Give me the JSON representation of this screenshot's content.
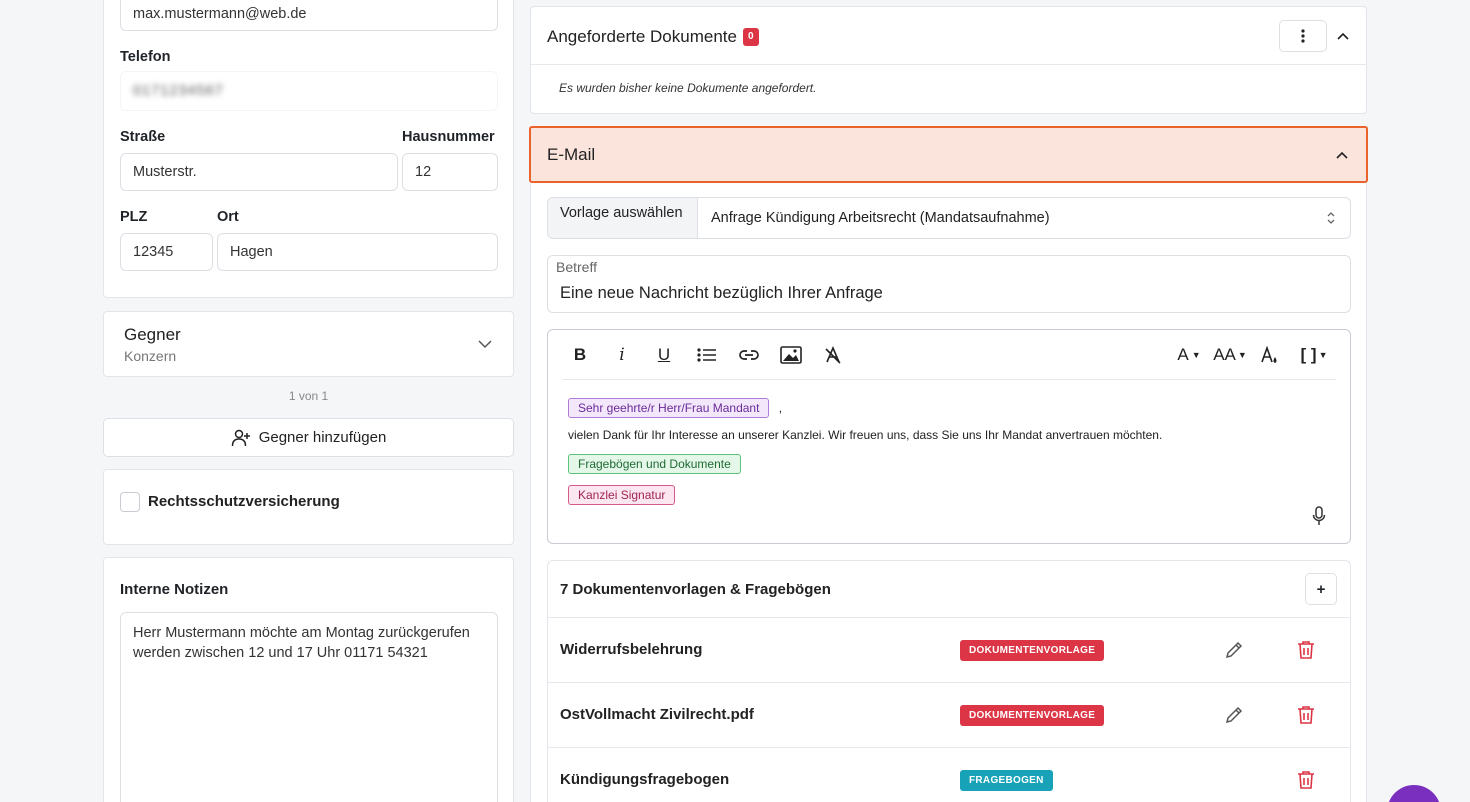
{
  "contact": {
    "email_value": "max.mustermann@web.de",
    "telefon_label": "Telefon",
    "telefon_value": "0171234567",
    "strasse_label": "Straße",
    "strasse_value": "Musterstr.",
    "hausnummer_label": "Hausnummer",
    "hausnummer_value": "12",
    "plz_label": "PLZ",
    "plz_value": "12345",
    "ort_label": "Ort",
    "ort_value": "Hagen"
  },
  "gegner": {
    "title": "Gegner",
    "subtitle": "Konzern",
    "pager": "1 von 1",
    "add_label": "Gegner hinzufügen"
  },
  "rechtsschutz": {
    "label": "Rechtsschutzversicherung",
    "checked": false
  },
  "notes": {
    "title": "Interne Notizen",
    "value": "Herr Mustermann möchte am Montag zurückgerufen werden zwischen 12 und 17 Uhr 01171 54321"
  },
  "docs": {
    "title": "Angeforderte Dokumente",
    "count": "0",
    "empty_text": "Es wurden bisher keine Dokumente angefordert."
  },
  "email": {
    "title": "E-Mail",
    "template_label": "Vorlage auswählen",
    "template_value": "Anfrage Kündigung Arbeitsrecht (Mandatsaufnahme)",
    "subject_label": "Betreff",
    "subject_value": "Eine neue Nachricht bezüglich Ihrer Anfrage",
    "chip_salutation": "Sehr geehrte/r Herr/Frau Mandant",
    "salutation_suffix": ",",
    "body_text": "vielen Dank für Ihr Interesse an unserer Kanzlei. Wir freuen uns, dass Sie uns Ihr Mandat anvertrauen möchten.",
    "chip_docs": "Fragebögen und Dokumente",
    "chip_signature": "Kanzlei Signatur"
  },
  "toolbar": {
    "bold": "B",
    "italic": "i",
    "underline": "U",
    "font_size": "A",
    "text_case": "AA",
    "brackets": "[ ]"
  },
  "templates": {
    "header": "7 Dokumentenvorlagen & Fragebögen",
    "add": "+",
    "rows": [
      {
        "name": "Widerrufsbelehrung",
        "badge": "DOKUMENTENVORLAGE",
        "badge_color": "#dc3545"
      },
      {
        "name": "OstVollmacht Zivilrecht.pdf",
        "badge": "DOKUMENTENVORLAGE",
        "badge_color": "#dc3545"
      },
      {
        "name": "Kündigungsfragebogen",
        "badge": "FRAGEBOGEN",
        "badge_color": "#17a2b8"
      }
    ]
  },
  "colors": {
    "accent_orange": "#e8642c",
    "highlight_bg": "#fbe4dc",
    "danger": "#dc3545",
    "info": "#17a2b8"
  }
}
